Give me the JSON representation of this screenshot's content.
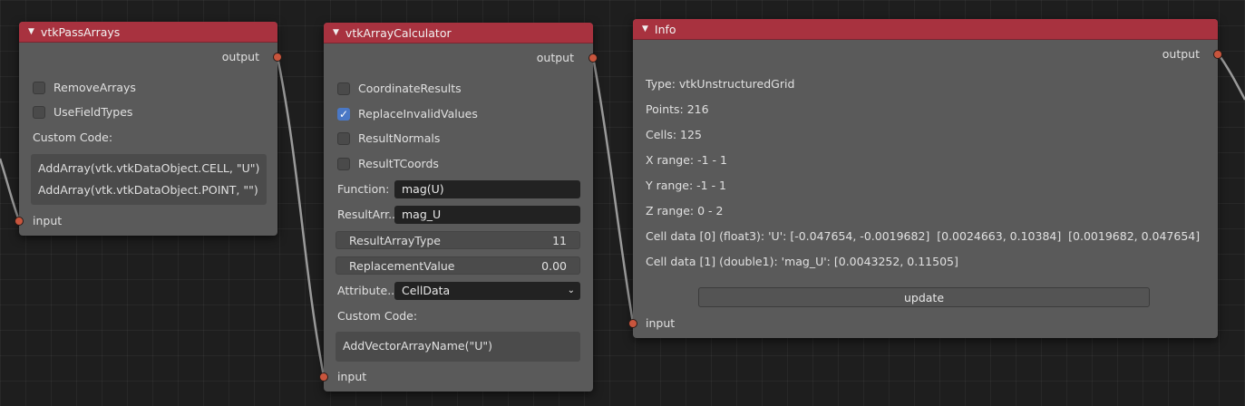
{
  "nodes": {
    "pass_arrays": {
      "title": "vtkPassArrays",
      "output_label": "output",
      "checkboxes": [
        {
          "label": "RemoveArrays",
          "checked": false
        },
        {
          "label": "UseFieldTypes",
          "checked": false
        }
      ],
      "custom_code_label": "Custom Code:",
      "code_lines": [
        "AddArray(vtk.vtkDataObject.CELL, \"U\")",
        "AddArray(vtk.vtkDataObject.POINT, \"\")"
      ],
      "input_label": "input"
    },
    "array_calculator": {
      "title": "vtkArrayCalculator",
      "output_label": "output",
      "checkboxes": [
        {
          "label": "CoordinateResults",
          "checked": false
        },
        {
          "label": "ReplaceInvalidValues",
          "checked": true
        },
        {
          "label": "ResultNormals",
          "checked": false
        },
        {
          "label": "ResultTCoords",
          "checked": false
        }
      ],
      "function_label": "Function:",
      "function_value": "mag(U)",
      "result_array_label": "ResultArr...",
      "result_array_value": "mag_U",
      "result_array_type_label": "ResultArrayType",
      "result_array_type_value": "11",
      "replacement_value_label": "ReplacementValue",
      "replacement_value_value": "0.00",
      "attribute_label": "Attribute...",
      "attribute_value": "CellData",
      "custom_code_label": "Custom Code:",
      "code_lines": [
        "AddVectorArrayName(\"U\")"
      ],
      "input_label": "input"
    },
    "info": {
      "title": "Info",
      "output_label": "output",
      "lines": [
        "Type: vtkUnstructuredGrid",
        "Points: 216",
        "Cells: 125",
        "X range: -1 - 1",
        "Y range: -1 - 1",
        "Z range: 0 - 2",
        "Cell data [0] (float3): 'U': [-0.047654, -0.0019682]  [0.0024663, 0.10384]  [0.0019682, 0.047654]",
        "Cell data [1] (double1): 'mag_U': [0.0043252, 0.11505]"
      ],
      "update_label": "update",
      "input_label": "input"
    }
  },
  "colors": {
    "header": "#a8323f",
    "node_body": "#5a5a5a",
    "socket": "#c8553d",
    "checkbox_checked": "#4a78c6",
    "link": "#9a9a9a"
  }
}
